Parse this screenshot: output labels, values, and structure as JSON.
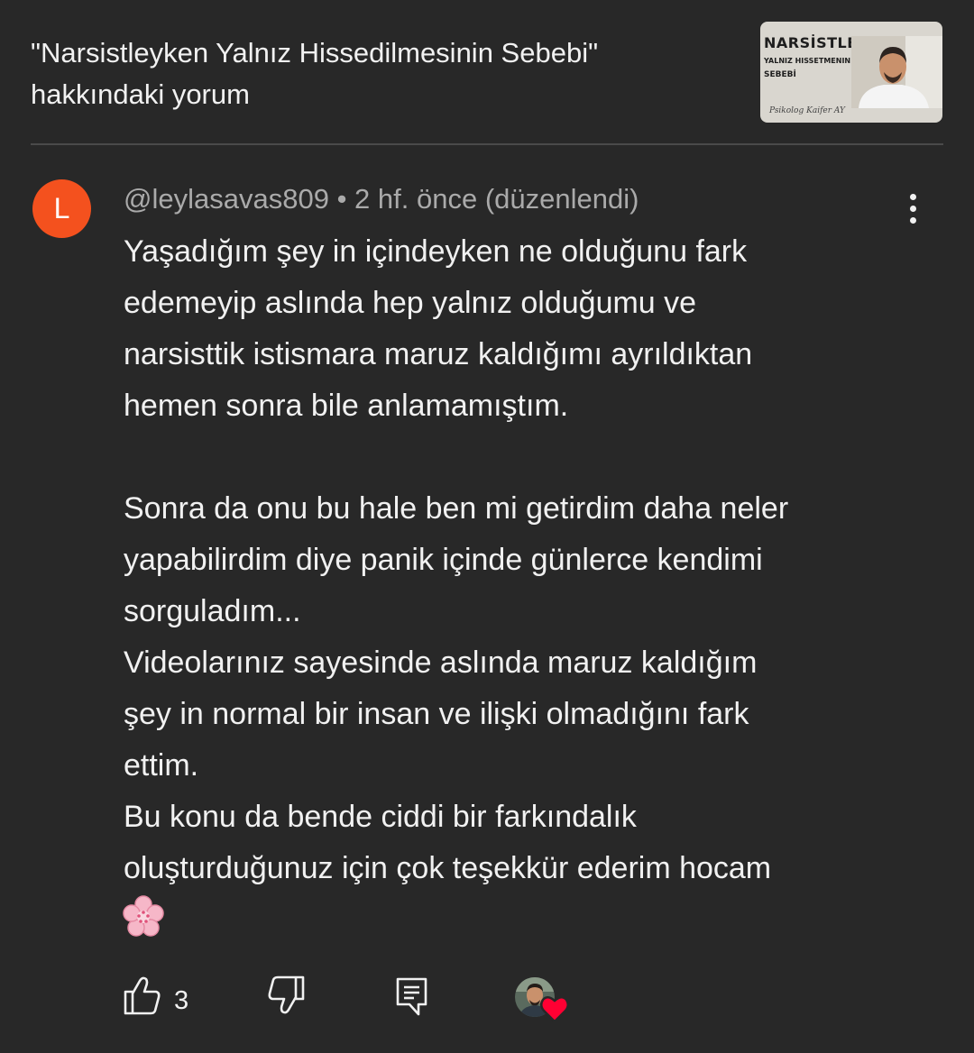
{
  "header": {
    "title": "\"Narsistleyken Yalnız Hissedilmesinin Sebebi\" hakkındaki yorum"
  },
  "thumbnail": {
    "line1": "NARSİSTLE",
    "line2": "YALNIZ HISSETMENIN",
    "line3": "SEBEBİ",
    "signature": "Psikolog Kaifer AY"
  },
  "comment": {
    "avatar_letter": "L",
    "author": "@leylasavas809",
    "separator": "•",
    "time": "2 hf. önce (düzenlendi)",
    "text": "Yaşadığım şey in içindeyken ne olduğunu fark\nedemeyip aslında hep yalnız olduğumu ve\nnarsisttik istismara maruz kaldığımı ayrıldıktan\nhemen sonra bile anlamamıştım.\n\nSonra da onu bu hale ben mi getirdim daha neler\nyapabilirdim diye panik içinde günlerce kendimi\nsorguladım...\nVideolarınız sayesinde aslında maruz kaldığım\nşey in normal bir insan ve ilişki olmadığını fark\nettim.\nBu konu da bende ciddi bir farkındalık\noluşturduğunuz için çok teşekkür ederim hocam",
    "emoji": "cherry-blossom"
  },
  "actions": {
    "like_count": "3",
    "icons": [
      "thumbs-up-icon",
      "thumbs-down-icon",
      "reply-icon",
      "creator-heart-icon"
    ]
  },
  "colors": {
    "background": "#282828",
    "text": "#f1f1f1",
    "meta": "#aaaaaa",
    "avatar": "#f4511e",
    "heart": "#ff0033"
  }
}
